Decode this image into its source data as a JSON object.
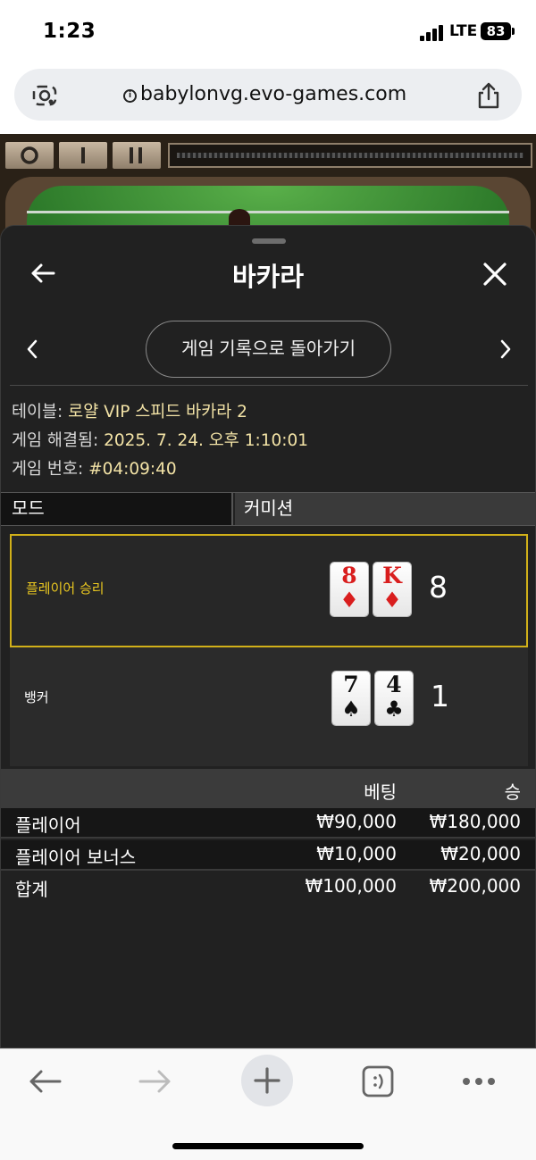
{
  "status_bar": {
    "time": "1:23",
    "network": "LTE",
    "battery": "83"
  },
  "browser": {
    "url": "babylonvg.evo-games.com"
  },
  "panel": {
    "title": "바카라",
    "history_button": "게임 기록으로 돌아가기",
    "info": {
      "table_label": "테이블:",
      "table_value": " 로얄 VIP 스피드 바카라 2",
      "resolved_label": "게임 해결됨:",
      "resolved_value": " 2025. 7. 24. 오후 1:10:01",
      "game_no_label": "게임 번호:",
      "game_no_value": " #04:09:40"
    },
    "mode": {
      "label": "모드",
      "value": "커미션"
    },
    "results": {
      "player": {
        "label": "플레이어 승리",
        "cards": [
          {
            "rank": "8",
            "suit": "♦"
          },
          {
            "rank": "K",
            "suit": "♦"
          }
        ],
        "score": "8"
      },
      "banker": {
        "label": "뱅커",
        "cards": [
          {
            "rank": "7",
            "suit": "♠"
          },
          {
            "rank": "4",
            "suit": "♣"
          }
        ],
        "score": "1"
      }
    },
    "bets": {
      "headers": {
        "bet": "베팅",
        "win": "승"
      },
      "rows": [
        {
          "name": "플레이어",
          "bet": "₩90,000",
          "win": "₩180,000"
        },
        {
          "name": "플레이어 보너스",
          "bet": "₩10,000",
          "win": "₩20,000"
        }
      ],
      "total": {
        "name": "합계",
        "bet": "₩100,000",
        "win": "₩200,000"
      }
    }
  },
  "colors": {
    "panel_bg": "#212121",
    "winner_border": "#d1b019",
    "info_value": "#f3e3a6",
    "red_suit": "#d91e1e"
  },
  "icons": {
    "status": [
      "signal-icon",
      "battery-icon"
    ],
    "url_bar": [
      "lens-icon",
      "info-icon",
      "share-icon"
    ],
    "panel": [
      "back-arrow-icon",
      "close-icon",
      "chevron-left-icon",
      "chevron-right-icon"
    ],
    "toolbar": [
      "back-icon",
      "forward-icon",
      "plus-icon",
      "tabs-icon",
      "more-icon"
    ]
  }
}
